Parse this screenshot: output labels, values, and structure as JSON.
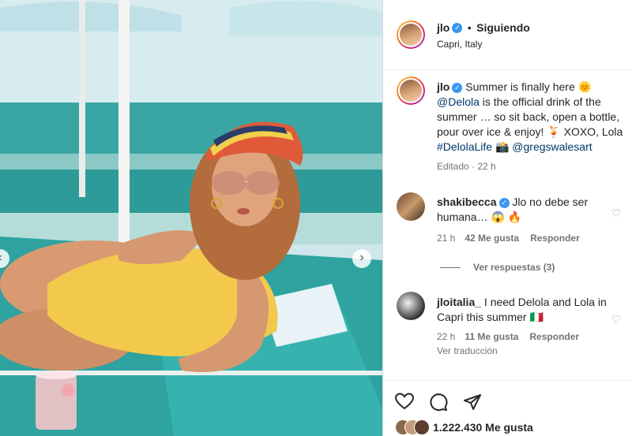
{
  "post": {
    "username": "jlo",
    "separator": "•",
    "follow_status": "Siguiendo",
    "location": "Capri, Italy"
  },
  "caption": {
    "username": "jlo",
    "line1": "Summer is finally here",
    "sun_emoji": "🌞",
    "mention": "@Delola",
    "line2": "is the official drink of the",
    "line3": "summer … so sit back, open a bottle,",
    "line4": "pour over ice & enjoy! 🍹 XOXO, Lola",
    "hashtag": "#DelolaLife",
    "camera_emoji": "📸",
    "mention2": "@gregswalesart",
    "edited": "Editado · 22 h"
  },
  "comments": [
    {
      "username": "shakibecca",
      "text1": "Jlo no debe ser",
      "text2": "humana…",
      "emojis": "😱 🔥",
      "time": "21 h",
      "likes": "42 Me gusta",
      "reply": "Responder",
      "view_replies": "Ver respuestas (3)"
    },
    {
      "username": "jloitalia_",
      "text1": "I need Delola and Lola in",
      "text2": "Capri this summer 🇮🇹",
      "time": "22 h",
      "likes": "11 Me gusta",
      "reply": "Responder",
      "translate": "Ver traducción"
    }
  ],
  "actions": {
    "like_icon": "heart-icon",
    "comment_icon": "comment-icon",
    "share_icon": "share-icon",
    "likes_count": "1.222.430 Me gusta"
  },
  "colors": {
    "accent_blue": "#3897f0",
    "link": "#00376b",
    "swimsuit": "#f2c94c",
    "lounger": "#2a9d9a"
  }
}
